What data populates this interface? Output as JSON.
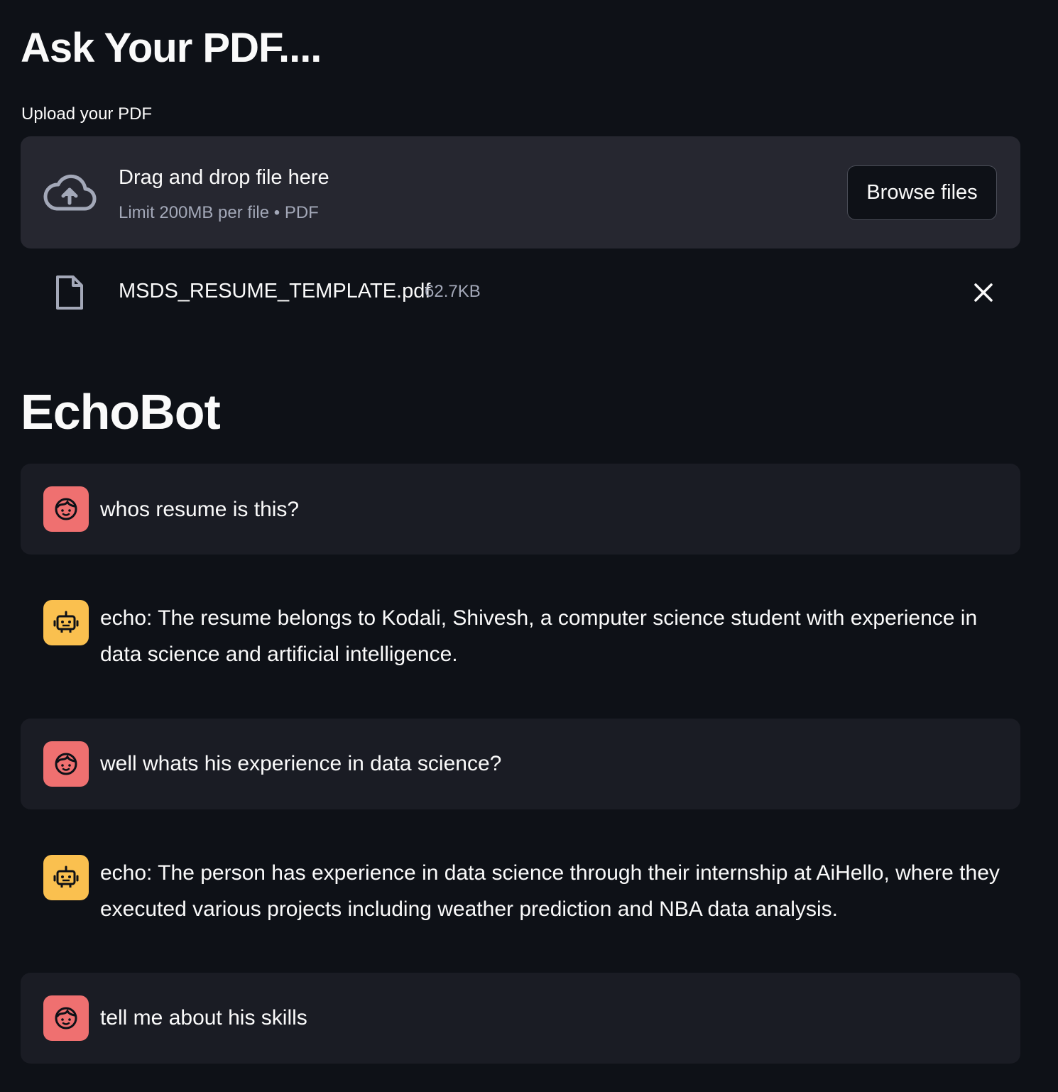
{
  "header": {
    "title": "Ask Your PDF...."
  },
  "uploader": {
    "label": "Upload your PDF",
    "drop_title": "Drag and drop file here",
    "drop_limit": "Limit 200MB per file • PDF",
    "browse_label": "Browse files",
    "cloud_icon": "cloud-upload-icon"
  },
  "uploaded_file": {
    "name": "MSDS_RESUME_TEMPLATE.pdf",
    "size": "62.7KB",
    "file_icon": "file-icon",
    "remove_icon": "close-icon"
  },
  "chat": {
    "title": "EchoBot",
    "messages": [
      {
        "role": "user",
        "text": "whos resume is this?"
      },
      {
        "role": "assistant",
        "text": "echo: The resume belongs to Kodali, Shivesh, a computer science student with experience in data science and artificial intelligence."
      },
      {
        "role": "user",
        "text": "well whats his experience in data science?"
      },
      {
        "role": "assistant",
        "text": "echo: The person has experience in data science through their internship at AiHello, where they executed various projects including weather prediction and NBA data analysis."
      },
      {
        "role": "user",
        "text": "tell me about his skills"
      }
    ]
  },
  "colors": {
    "background": "#0e1117",
    "dropzone": "#262730",
    "user_message_bg": "#1a1c24",
    "user_avatar": "#ef7070",
    "bot_avatar": "#fac04f"
  }
}
